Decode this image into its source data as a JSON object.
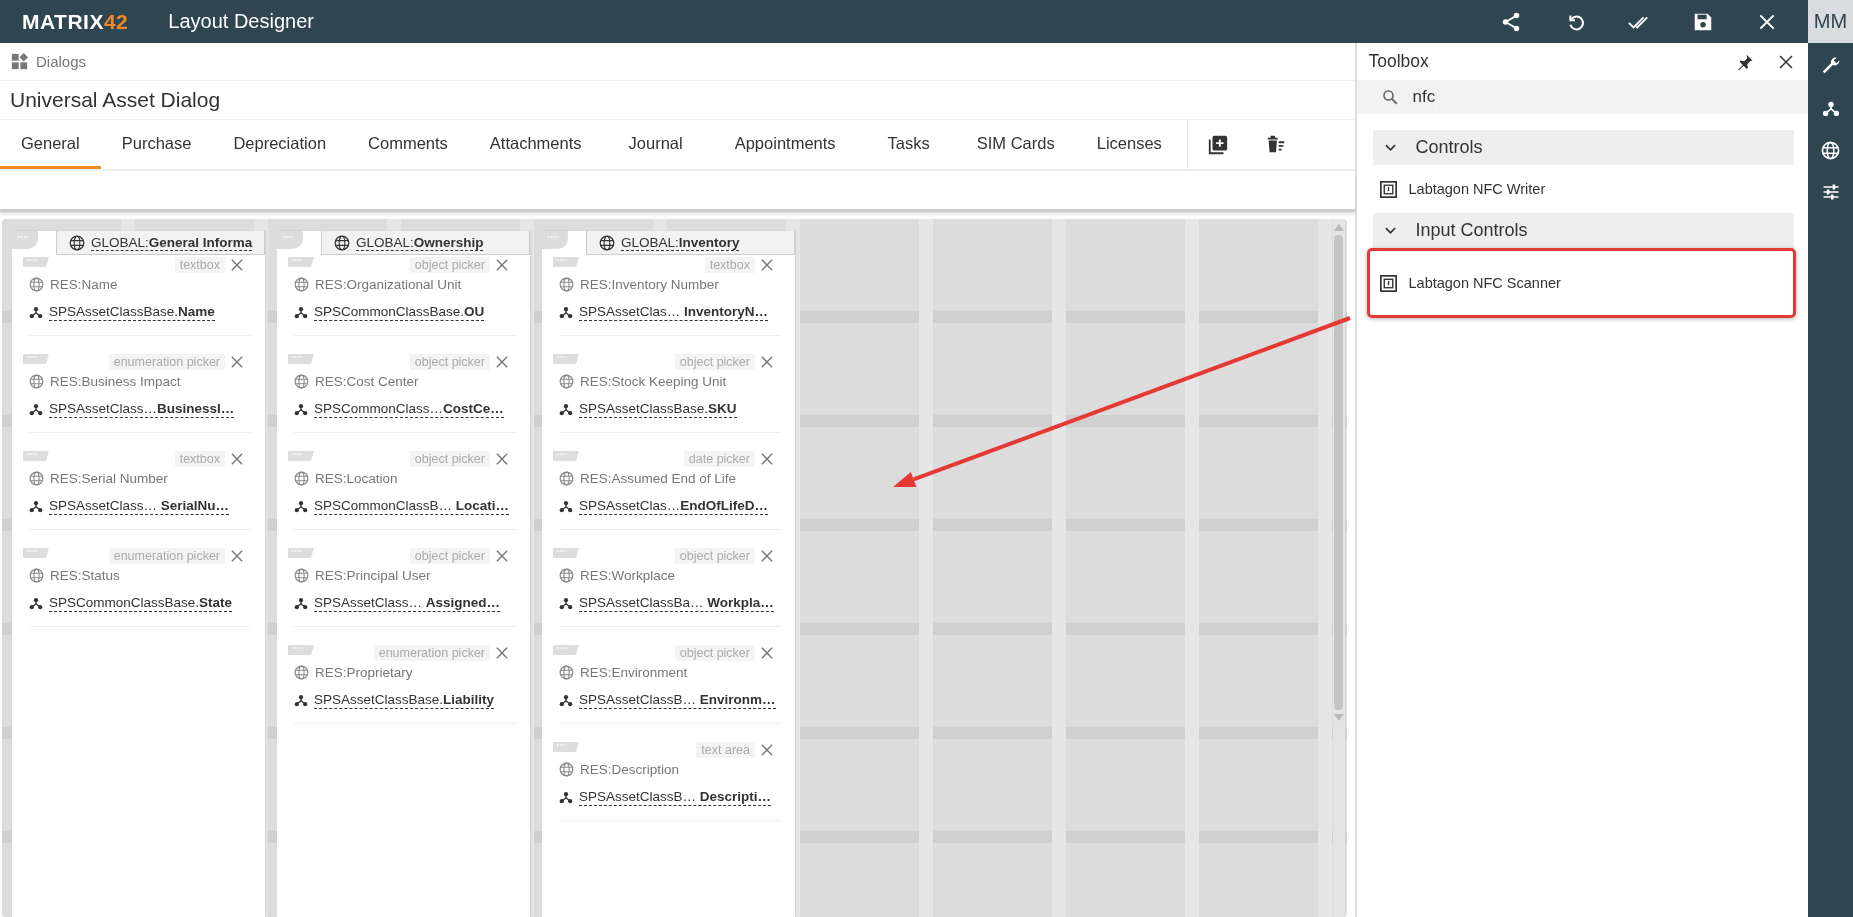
{
  "app": {
    "logo": "MATRIX",
    "logo_accent": "42",
    "title": "Layout Designer",
    "user_initials": "MM"
  },
  "breadcrumb": "Dialogs",
  "dialog_title": "Universal Asset Dialog",
  "tabs": [
    {
      "label": "General",
      "selected": true
    },
    {
      "label": "Purchase",
      "selected": false
    },
    {
      "label": "Depreciation",
      "selected": false
    },
    {
      "label": "Comments",
      "selected": false
    },
    {
      "label": "Attachments",
      "selected": false
    },
    {
      "label": "Journal",
      "selected": false
    },
    {
      "label": "Appointments",
      "selected": false
    },
    {
      "label": "Tasks",
      "selected": false
    },
    {
      "label": "SIM Cards",
      "selected": false
    },
    {
      "label": "Licenses",
      "selected": false
    }
  ],
  "columns": [
    {
      "title": "GLOBAL:**General Informa**",
      "fields": [
        {
          "label": "RES:Name",
          "type": "textbox",
          "binding": "SPSAssetClassBase.**Name**"
        },
        {
          "label": "RES:Business Impact",
          "type": "enumeration picker",
          "binding": "SPSAssetClass…**BusinessI…**"
        },
        {
          "label": "RES:Serial Number",
          "type": "textbox",
          "binding": "SPSAssetClass… **SerialNu…**"
        },
        {
          "label": "RES:Status",
          "type": "enumeration picker",
          "binding": "SPSCommonClassBase.**State**"
        }
      ]
    },
    {
      "title": "GLOBAL:**Ownership**",
      "fields": [
        {
          "label": "RES:Organizational Unit",
          "type": "object picker",
          "binding": "SPSCommonClassBase.**OU**"
        },
        {
          "label": "RES:Cost Center",
          "type": "object picker",
          "binding": "SPSCommonClass…**CostCe…**"
        },
        {
          "label": "RES:Location",
          "type": "object picker",
          "binding": "SPSCommonClassB… **Locati…**"
        },
        {
          "label": "RES:Principal User",
          "type": "object picker",
          "binding": "SPSAssetClass… **Assigned…**"
        },
        {
          "label": "RES:Proprietary",
          "type": "enumeration picker",
          "binding": "SPSAssetClassBase.**Liability**"
        }
      ]
    },
    {
      "title": "GLOBAL:**Inventory**",
      "fields": [
        {
          "label": "RES:Inventory Number",
          "type": "textbox",
          "binding": "SPSAssetClas… **InventoryN…**"
        },
        {
          "label": "RES:Stock Keeping Unit",
          "type": "object picker",
          "binding": "SPSAssetClassBase.**SKU**"
        },
        {
          "label": "RES:Assumed End of Life",
          "type": "date picker",
          "binding": "SPSAssetClas…**EndOfLifeD…**"
        },
        {
          "label": "RES:Workplace",
          "type": "object picker",
          "binding": "SPSAssetClassBa… **Workpla…**"
        },
        {
          "label": "RES:Environment",
          "type": "object picker",
          "binding": "SPSAssetClassB… **Environm…**"
        },
        {
          "label": "RES:Description",
          "type": "text area",
          "binding": "SPSAssetClassB… **Descripti…**"
        }
      ]
    }
  ],
  "toolbox": {
    "title": "Toolbox",
    "search": {
      "value": "nfc"
    },
    "groups": [
      {
        "label": "Controls",
        "expanded": true,
        "items": [
          {
            "label": "Labtagon NFC Writer",
            "highlighted": false
          }
        ]
      },
      {
        "label": "Input Controls",
        "expanded": true,
        "items": [
          {
            "label": "Labtagon NFC Scanner",
            "highlighted": true
          }
        ]
      }
    ]
  }
}
